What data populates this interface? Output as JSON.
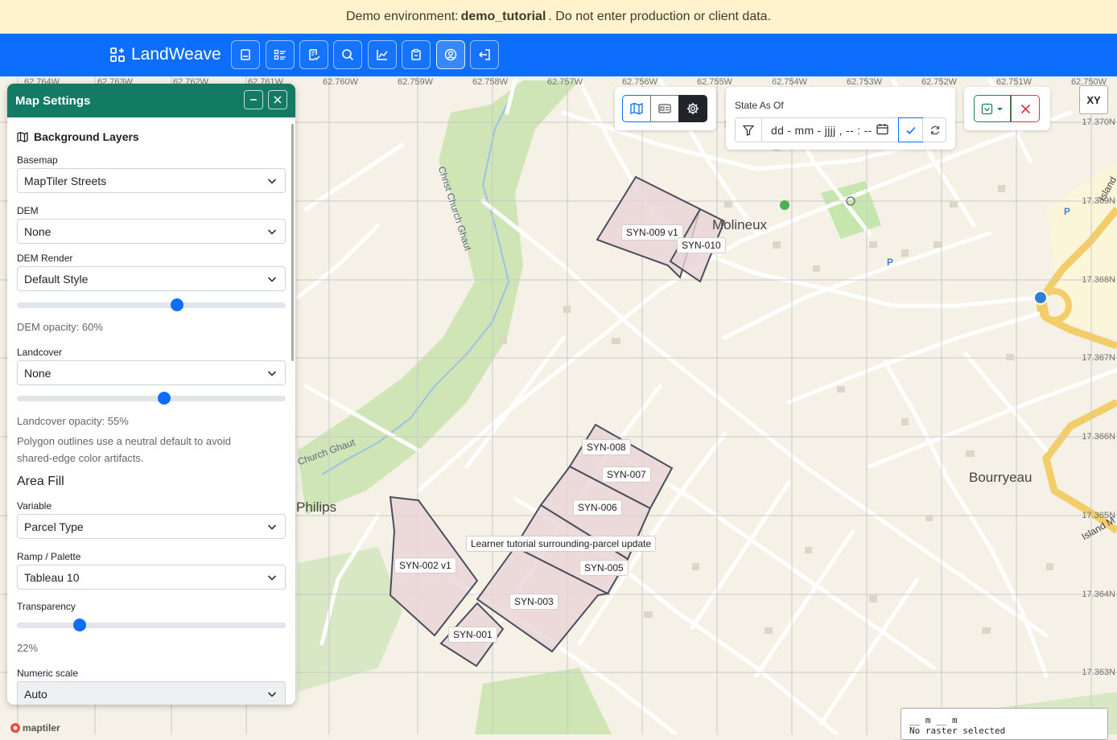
{
  "banner": {
    "prefix": "Demo environment:",
    "env": "demo_tutorial",
    "suffix": ". Do not enter production or client data."
  },
  "navbar": {
    "brand": "LandWeave",
    "buttons": [
      {
        "name": "records-nav-button",
        "icon": "book-icon"
      },
      {
        "name": "list-nav-button",
        "icon": "list-check-icon"
      },
      {
        "name": "review-nav-button",
        "icon": "clipboard-check-icon"
      },
      {
        "name": "search-nav-button",
        "icon": "search-icon"
      },
      {
        "name": "reports-nav-button",
        "icon": "chart-icon"
      },
      {
        "name": "tasks-nav-button",
        "icon": "clipboard-icon"
      },
      {
        "name": "profile-nav-button",
        "icon": "user-circle-icon"
      },
      {
        "name": "logout-nav-button",
        "icon": "logout-icon"
      }
    ]
  },
  "map": {
    "top_coords": [
      "62.764W",
      "62.763W",
      "62.762W",
      "62.761W",
      "62.760W",
      "62.759W",
      "62.758W",
      "62.757W",
      "62.756W",
      "62.755W",
      "62.754W",
      "62.753W",
      "62.752W",
      "62.751W",
      "62.750W"
    ],
    "right_coords": [
      "17.370N",
      "17.369N",
      "17.368N",
      "17.367N",
      "17.366N",
      "17.365N",
      "17.364N",
      "17.363N"
    ],
    "place_labels": {
      "molineux": "Molineux",
      "bourryeau": "Bourryeau",
      "philips": "Philips",
      "island_a": "Island",
      "island_b": "Island M"
    },
    "street_labels": {
      "christ_church_ghaut": "Christ Church Ghaut",
      "church_ghaut": "Church Ghaut"
    },
    "parcels": [
      {
        "id": "SYN-009 v1"
      },
      {
        "id": "SYN-010"
      },
      {
        "id": "SYN-008"
      },
      {
        "id": "SYN-007"
      },
      {
        "id": "SYN-006"
      },
      {
        "id": "SYN-005"
      },
      {
        "id": "SYN-003"
      },
      {
        "id": "SYN-002 v1"
      },
      {
        "id": "SYN-001"
      }
    ],
    "tooltip": "Learner tutorial surrounding-parcel update",
    "xy_button": "XY",
    "scale_line": "__ m __ m",
    "raster_status": "No raster selected",
    "attribution": "maptiler",
    "colors": {
      "parcel_fill": "#e8d4d6",
      "parcel_stroke": "#4a4e5e",
      "park": "#c8e6b0",
      "road": "#ffffff"
    }
  },
  "state_panel": {
    "title": "State As Of",
    "date_value": "dd - mm - jjjj ,  -- : --"
  },
  "panel": {
    "title": "Map Settings",
    "background_layers": "Background Layers",
    "basemap_label": "Basemap",
    "basemap_value": "MapTiler Streets",
    "dem_label": "DEM",
    "dem_value": "None",
    "dem_render_label": "DEM Render",
    "dem_render_value": "Default Style",
    "dem_opacity_text": "DEM opacity: 60%",
    "dem_opacity": 0.6,
    "landcover_label": "Landcover",
    "landcover_value": "None",
    "landcover_opacity_text": "Landcover opacity: 55%",
    "landcover_opacity": 0.55,
    "note": "Polygon outlines use a neutral default to avoid shared-edge color artifacts.",
    "area_fill": "Area Fill",
    "variable_label": "Variable",
    "variable_value": "Parcel Type",
    "ramp_label": "Ramp / Palette",
    "ramp_value": "Tableau 10",
    "transparency_label": "Transparency",
    "transparency_text": "22%",
    "transparency": 0.22,
    "numeric_scale_label": "Numeric scale",
    "numeric_scale_value": "Auto"
  }
}
